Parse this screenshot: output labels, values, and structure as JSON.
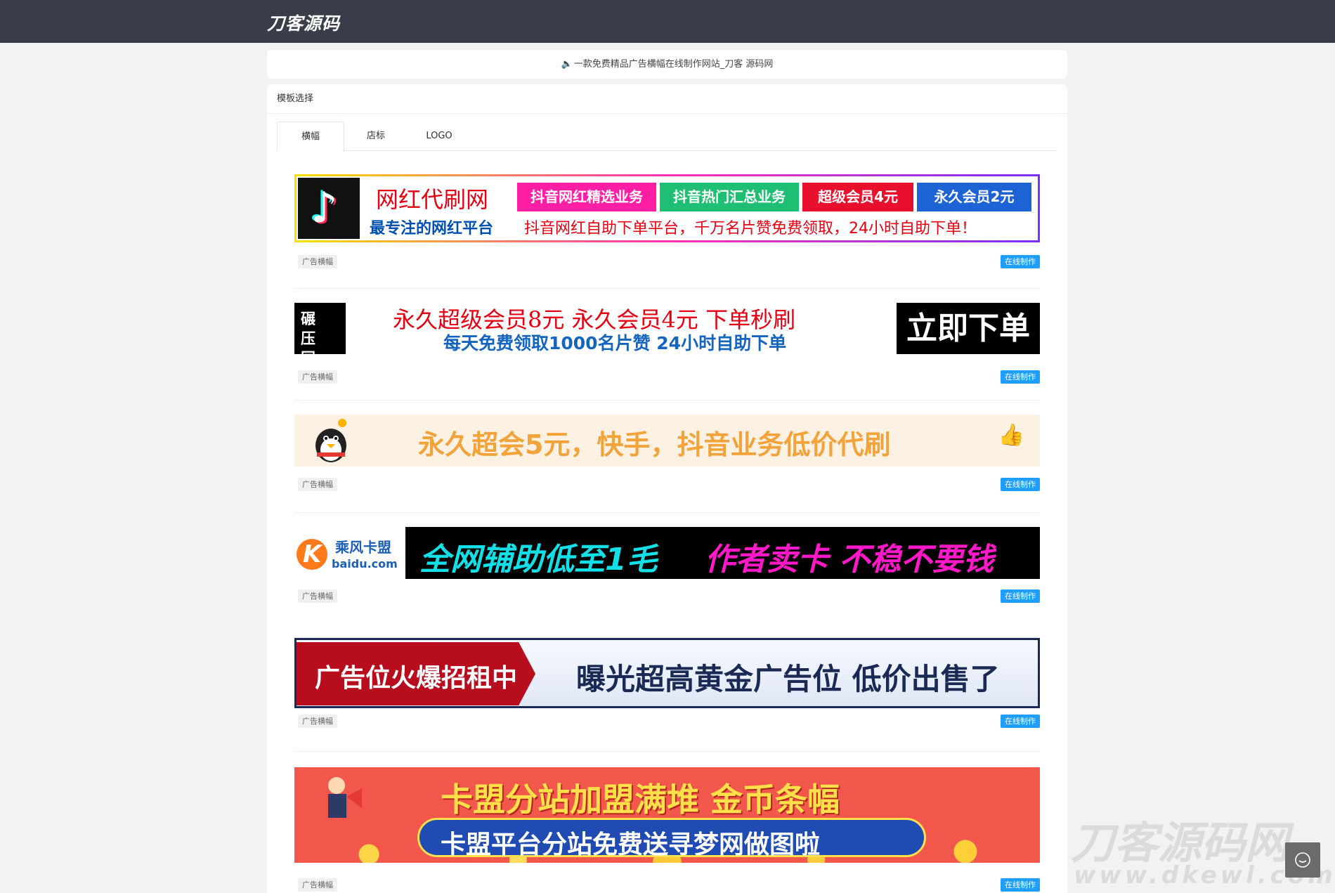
{
  "header": {
    "brand": "刀客源码"
  },
  "notice": {
    "text": "一款免费精品广告横幅在线制作网站_刀客 源码网"
  },
  "panel": {
    "title": "模板选择",
    "tabs": [
      {
        "label": "横幅"
      },
      {
        "label": "店标"
      },
      {
        "label": "LOGO"
      }
    ]
  },
  "cards": {
    "tag_label": "广告横幅",
    "button_label": "在线制作"
  },
  "banners": {
    "b1": {
      "name": "网红代刷网",
      "chips": [
        "抖音网红精选业务",
        "抖音热门汇总业务",
        "超级会员4元",
        "永久会员2元"
      ],
      "chip_colors": [
        "#ff1fa5",
        "#1fbf73",
        "#e8102d",
        "#1e63d6"
      ],
      "slogan": "最专注的网红平台",
      "desc": "抖音网红自助下单平台，千万名片赞免费领取，24小时自助下单！"
    },
    "b2": {
      "seal": "碾压同行",
      "line1": "永久超级会员8元  永久会员4元  下单秒刷",
      "line2": "每天免费领取1000名片赞  24小时自助下单",
      "order": "立即下单"
    },
    "b3": {
      "text": "永久超会5元，快手，抖音业务低价代刷"
    },
    "b4": {
      "name": "乘风卡盟",
      "domain": "baidu.com",
      "s1": "全网辅助低至1毛",
      "s2": "作者卖卡 不稳不要钱"
    },
    "b5": {
      "ribbon": "广告位火爆招租中",
      "pitch": "曝光超高黄金广告位 低价出售了"
    },
    "b6": {
      "t1": "卡盟分站加盟满堆 金币条幅",
      "t2": "卡盟平台分站免费送寻梦网做图啦"
    }
  },
  "watermark": {
    "line1": "刀客源码网",
    "line2": "www.dkewl.com"
  },
  "colors": {
    "topbar": "#393d49",
    "accent": "#1e9fff"
  }
}
